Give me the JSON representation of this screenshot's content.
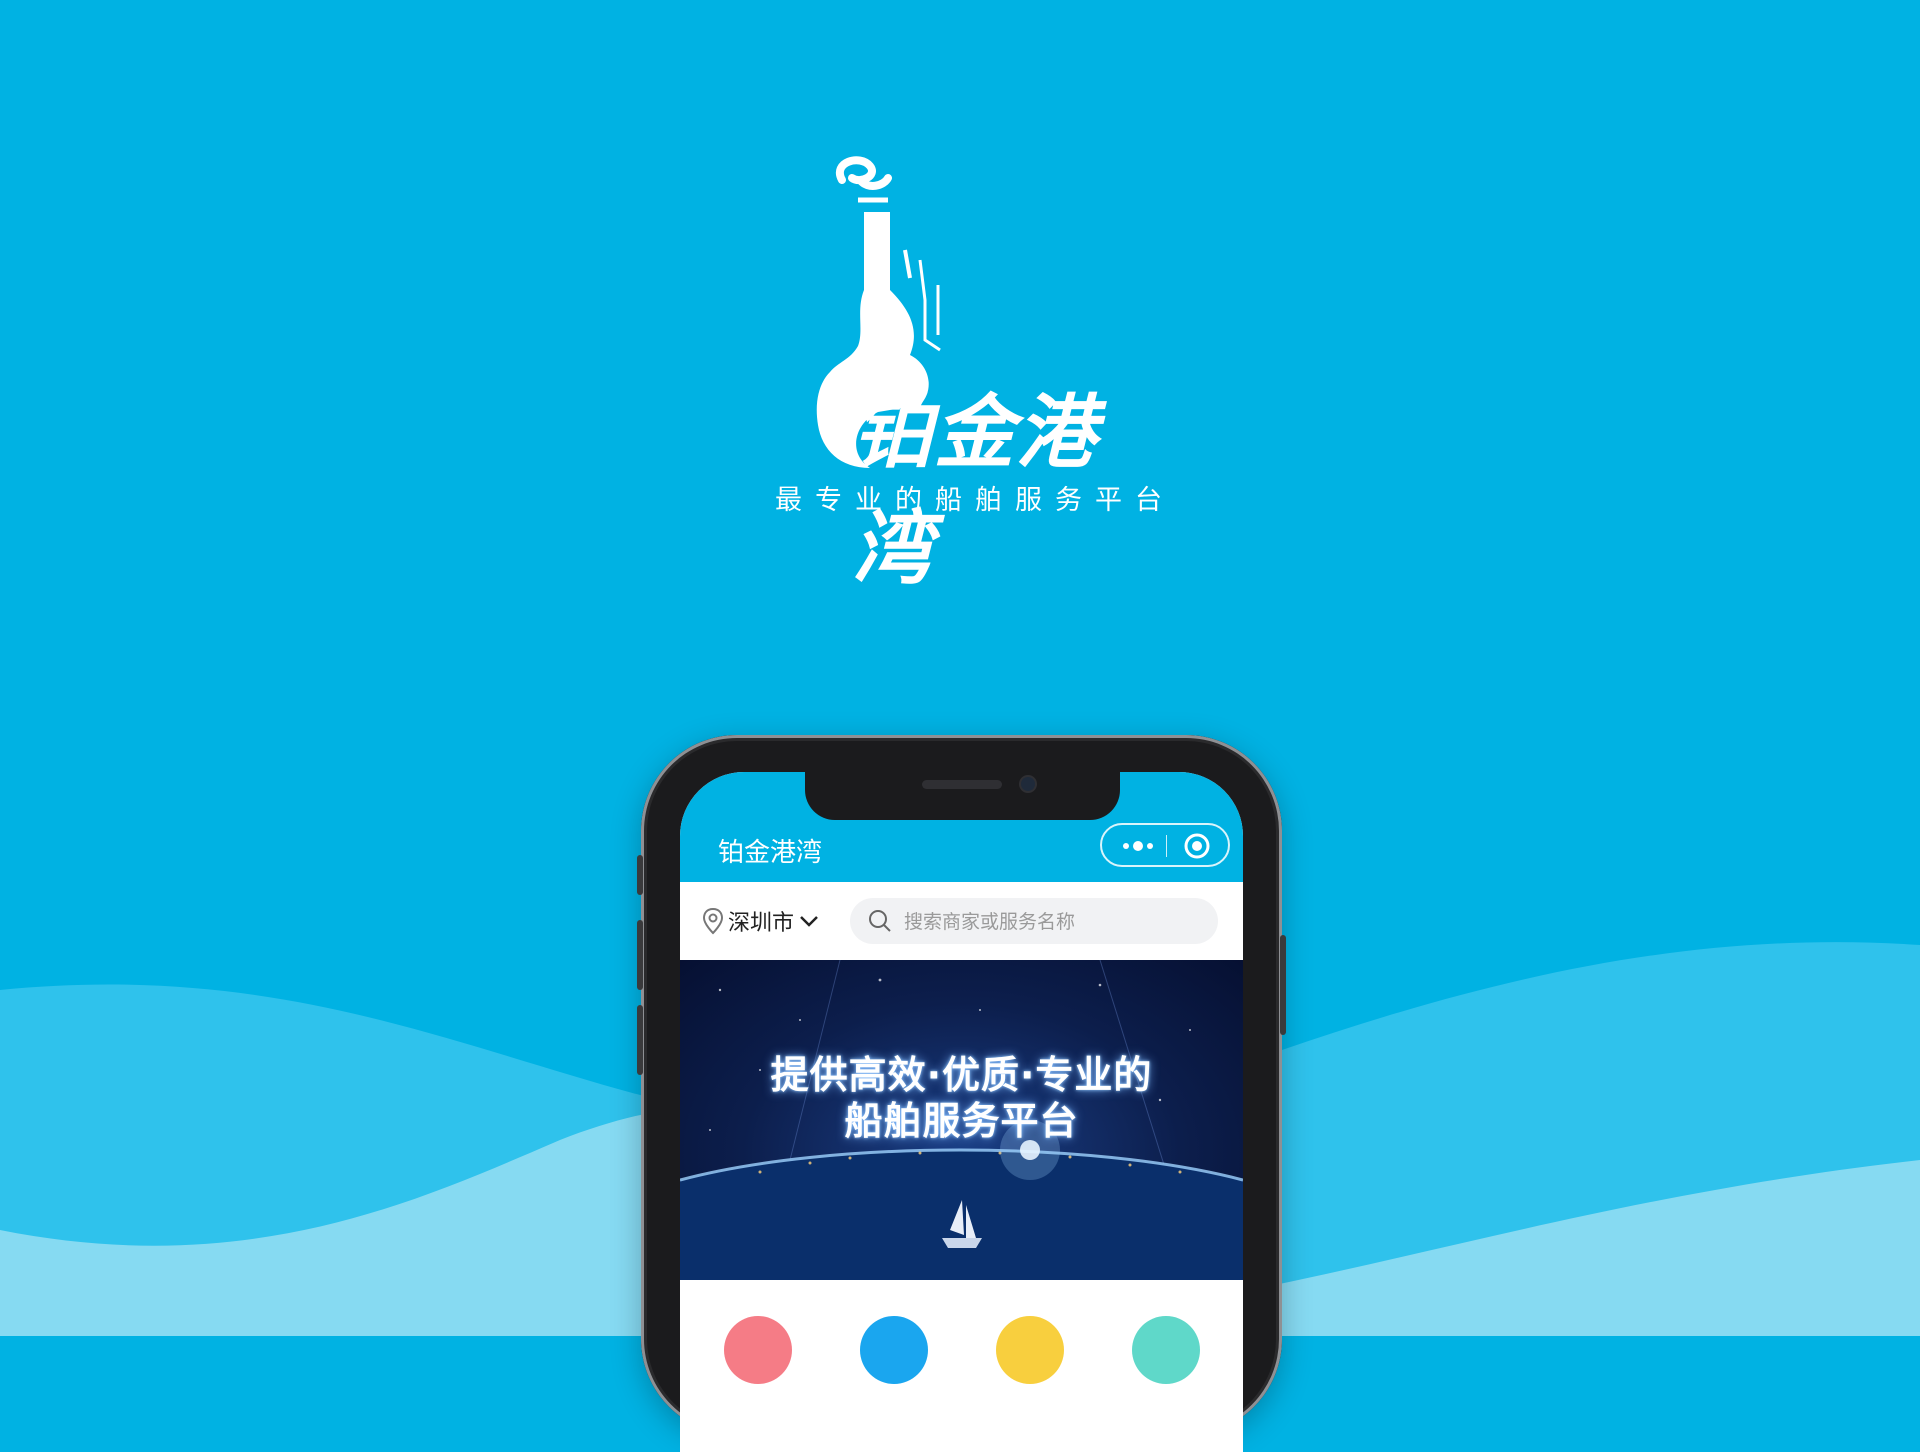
{
  "colors": {
    "background": "#00b2e3",
    "wave_mid": "#2fc2ec",
    "wave_light": "#86daf2",
    "titlebar": "#00b2e3",
    "banner_dark": "#0c1e4c"
  },
  "logo": {
    "brand_name": "铂金港湾",
    "slogan": "最专业的船舶服务平台"
  },
  "app": {
    "title": "铂金港湾",
    "capsule": {
      "more_icon": "more-dots-icon",
      "close_icon": "target-circle-icon"
    },
    "location": {
      "city": "深圳市",
      "icon": "location-pin-icon",
      "dropdown_icon": "chevron-down-icon"
    },
    "search": {
      "placeholder": "搜索商家或服务名称",
      "icon": "search-icon"
    },
    "banner": {
      "line1": "提供高效·优质·专业的",
      "line2": "船舶服务平台"
    },
    "categories": [
      {
        "icon": "category-icon-red",
        "color": "#f57c86"
      },
      {
        "icon": "category-icon-blue",
        "color": "#1aa6ef"
      },
      {
        "icon": "category-icon-yellow",
        "color": "#f8cf3e"
      },
      {
        "icon": "category-icon-teal",
        "color": "#5fd8c9"
      }
    ]
  }
}
